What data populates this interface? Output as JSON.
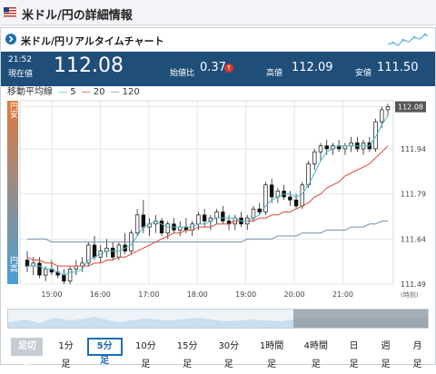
{
  "page": {
    "title": "米ドル/円の詳細情報"
  },
  "widget": {
    "title": "米ドル/円リアルタイムチャート"
  },
  "quote": {
    "time": "21:52",
    "price_label": "現在値",
    "price": "112.08",
    "change_label": "始値比",
    "change": "0.37",
    "change_direction": "up",
    "high_label": "高値",
    "high": "112.09",
    "low_label": "安値",
    "low": "111.50"
  },
  "legend": {
    "title": "移動平均線",
    "ma_short": "5",
    "ma_mid": "20",
    "ma_long": "120"
  },
  "side_labels": {
    "top": "円安",
    "bottom": "円高"
  },
  "colors": {
    "header_bg": "#1f4e79",
    "accent": "#1a6cb4",
    "ma_short": "#4db8c8",
    "ma_mid": "#d64b3c",
    "ma_long": "#6e8fb0",
    "yen_weak": "#e07a3e",
    "yen_strong": "#4a9fd6"
  },
  "chart_data": {
    "type": "candlestick",
    "x_ticks": [
      "15:00",
      "16:00",
      "17:00",
      "18:00",
      "19:00",
      "20:00",
      "21:00"
    ],
    "y_ticks": [
      112.08,
      111.94,
      111.79,
      111.64,
      111.49
    ],
    "ylim": [
      111.49,
      112.1
    ],
    "current_price_label": "112.08",
    "axis_note": "(時刻)",
    "grid": true,
    "candles": [
      [
        111.57,
        111.6,
        111.53,
        111.55
      ],
      [
        111.55,
        111.58,
        111.52,
        111.56
      ],
      [
        111.56,
        111.58,
        111.51,
        111.52
      ],
      [
        111.52,
        111.55,
        111.5,
        111.54
      ],
      [
        111.54,
        111.57,
        111.52,
        111.53
      ],
      [
        111.53,
        111.55,
        111.51,
        111.52
      ],
      [
        111.52,
        111.54,
        111.49,
        111.5
      ],
      [
        111.5,
        111.55,
        111.49,
        111.54
      ],
      [
        111.54,
        111.57,
        111.52,
        111.55
      ],
      [
        111.55,
        111.58,
        111.53,
        111.56
      ],
      [
        111.56,
        111.63,
        111.55,
        111.62
      ],
      [
        111.62,
        111.65,
        111.57,
        111.58
      ],
      [
        111.58,
        111.62,
        111.56,
        111.6
      ],
      [
        111.6,
        111.64,
        111.58,
        111.61
      ],
      [
        111.61,
        111.63,
        111.57,
        111.58
      ],
      [
        111.58,
        111.63,
        111.57,
        111.62
      ],
      [
        111.62,
        111.66,
        111.59,
        111.6
      ],
      [
        111.6,
        111.67,
        111.59,
        111.66
      ],
      [
        111.66,
        111.74,
        111.65,
        111.72
      ],
      [
        111.72,
        111.77,
        111.66,
        111.68
      ],
      [
        111.68,
        111.71,
        111.65,
        111.69
      ],
      [
        111.69,
        111.72,
        111.66,
        111.7
      ],
      [
        111.7,
        111.71,
        111.65,
        111.66
      ],
      [
        111.66,
        111.7,
        111.64,
        111.69
      ],
      [
        111.69,
        111.71,
        111.66,
        111.67
      ],
      [
        111.67,
        111.7,
        111.65,
        111.68
      ],
      [
        111.68,
        111.71,
        111.66,
        111.67
      ],
      [
        111.67,
        111.7,
        111.65,
        111.69
      ],
      [
        111.69,
        111.73,
        111.67,
        111.72
      ],
      [
        111.72,
        111.74,
        111.68,
        111.7
      ],
      [
        111.7,
        111.72,
        111.67,
        111.71
      ],
      [
        111.71,
        111.74,
        111.69,
        111.73
      ],
      [
        111.73,
        111.75,
        111.69,
        111.7
      ],
      [
        111.7,
        111.72,
        111.67,
        111.69
      ],
      [
        111.69,
        111.72,
        111.67,
        111.71
      ],
      [
        111.71,
        111.73,
        111.68,
        111.69
      ],
      [
        111.69,
        111.72,
        111.67,
        111.71
      ],
      [
        111.71,
        111.75,
        111.7,
        111.74
      ],
      [
        111.74,
        111.76,
        111.72,
        111.73
      ],
      [
        111.73,
        111.83,
        111.72,
        111.82
      ],
      [
        111.82,
        111.84,
        111.76,
        111.78
      ],
      [
        111.78,
        111.81,
        111.76,
        111.8
      ],
      [
        111.8,
        111.82,
        111.77,
        111.78
      ],
      [
        111.78,
        111.8,
        111.75,
        111.77
      ],
      [
        111.77,
        111.79,
        111.74,
        111.75
      ],
      [
        111.75,
        111.83,
        111.74,
        111.82
      ],
      [
        111.82,
        111.9,
        111.81,
        111.89
      ],
      [
        111.89,
        111.94,
        111.87,
        111.93
      ],
      [
        111.93,
        111.96,
        111.9,
        111.95
      ],
      [
        111.95,
        111.97,
        111.92,
        111.94
      ],
      [
        111.94,
        111.96,
        111.92,
        111.95
      ],
      [
        111.95,
        111.97,
        111.93,
        111.94
      ],
      [
        111.94,
        111.96,
        111.92,
        111.95
      ],
      [
        111.95,
        111.98,
        111.93,
        111.96
      ],
      [
        111.96,
        111.98,
        111.93,
        111.94
      ],
      [
        111.94,
        111.97,
        111.92,
        111.96
      ],
      [
        111.96,
        111.98,
        111.93,
        111.94
      ],
      [
        111.94,
        112.04,
        111.93,
        112.03
      ],
      [
        112.03,
        112.08,
        112.01,
        112.07
      ],
      [
        112.07,
        112.09,
        112.05,
        112.08
      ]
    ],
    "ma_short": [
      111.55,
      111.55,
      111.55,
      111.54,
      111.54,
      111.53,
      111.52,
      111.53,
      111.53,
      111.54,
      111.57,
      111.58,
      111.59,
      111.6,
      111.6,
      111.6,
      111.61,
      111.62,
      111.65,
      111.68,
      111.69,
      111.7,
      111.69,
      111.68,
      111.68,
      111.68,
      111.68,
      111.68,
      111.69,
      111.69,
      111.7,
      111.71,
      111.71,
      111.71,
      111.71,
      111.7,
      111.7,
      111.71,
      111.72,
      111.75,
      111.77,
      111.78,
      111.79,
      111.79,
      111.78,
      111.79,
      111.82,
      111.86,
      111.9,
      111.93,
      111.94,
      111.95,
      111.95,
      111.95,
      111.95,
      111.95,
      111.95,
      111.98,
      112.02,
      112.05
    ],
    "ma_mid": [
      111.58,
      111.57,
      111.57,
      111.56,
      111.56,
      111.55,
      111.55,
      111.55,
      111.55,
      111.55,
      111.55,
      111.56,
      111.56,
      111.57,
      111.57,
      111.58,
      111.58,
      111.59,
      111.6,
      111.61,
      111.62,
      111.63,
      111.64,
      111.65,
      111.66,
      111.66,
      111.67,
      111.67,
      111.68,
      111.68,
      111.68,
      111.69,
      111.69,
      111.69,
      111.7,
      111.7,
      111.7,
      111.7,
      111.71,
      111.71,
      111.72,
      111.72,
      111.73,
      111.73,
      111.74,
      111.75,
      111.76,
      111.78,
      111.79,
      111.81,
      111.82,
      111.83,
      111.85,
      111.86,
      111.87,
      111.88,
      111.89,
      111.91,
      111.93,
      111.95
    ],
    "ma_long": [
      111.64,
      111.64,
      111.64,
      111.64,
      111.63,
      111.63,
      111.63,
      111.63,
      111.63,
      111.63,
      111.63,
      111.63,
      111.63,
      111.63,
      111.63,
      111.63,
      111.63,
      111.63,
      111.63,
      111.63,
      111.63,
      111.63,
      111.63,
      111.63,
      111.63,
      111.63,
      111.63,
      111.63,
      111.63,
      111.63,
      111.63,
      111.63,
      111.63,
      111.63,
      111.63,
      111.63,
      111.64,
      111.64,
      111.64,
      111.64,
      111.64,
      111.65,
      111.65,
      111.65,
      111.65,
      111.66,
      111.66,
      111.66,
      111.66,
      111.67,
      111.67,
      111.67,
      111.67,
      111.68,
      111.68,
      111.68,
      111.69,
      111.69,
      111.7,
      111.7
    ]
  },
  "timeframes": {
    "fixed_label": "足切替",
    "buttons": [
      "1分足",
      "5分足",
      "10分足",
      "15分足",
      "30分足",
      "1時間足",
      "4時間足",
      "日足",
      "週足",
      "月足"
    ],
    "active": "5分足"
  }
}
